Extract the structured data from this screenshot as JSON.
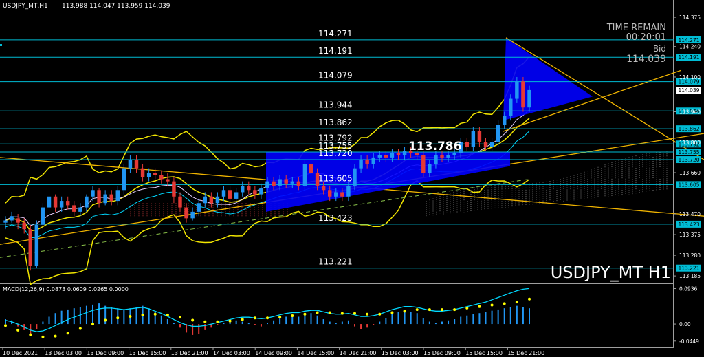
{
  "header": {
    "symbol": "USDJPY_MT,H1",
    "ohlc": "113.988 114.047 113.959 114.039"
  },
  "info": {
    "time_remain_label": "TIME REMAIN",
    "time_remain_value": "00:20:01",
    "bid_label": "Bid",
    "bid_value": "114.039"
  },
  "watermark": "USDJPY_MT H1",
  "pattern_label": "113.786",
  "colors": {
    "level_line": "#00bcd4",
    "bull": "#2196f3",
    "bear": "#e53935",
    "band": "#f2e600",
    "trend": "#f0b400",
    "triangle": "#0000ff",
    "macd_line": "#00d8ff",
    "macd_signal": "#ffff00"
  },
  "levels": [
    {
      "label": "114.271",
      "price": 114.271
    },
    {
      "label": "114.191",
      "price": 114.191
    },
    {
      "label": "114.079",
      "price": 114.079
    },
    {
      "label": "113.944",
      "price": 113.944
    },
    {
      "label": "113.862",
      "price": 113.862
    },
    {
      "label": "113.792",
      "price": 113.792
    },
    {
      "label": "113.755",
      "price": 113.755
    },
    {
      "label": "113.720",
      "price": 113.72
    },
    {
      "label": "113.605",
      "price": 113.605
    },
    {
      "label": "113.423",
      "price": 113.423
    },
    {
      "label": "113.221",
      "price": 113.221
    }
  ],
  "price_axis": {
    "ticks": [
      "114.375",
      "114.240",
      "114.100",
      "113.940",
      "113.800",
      "113.660",
      "113.470",
      "113.375",
      "113.280",
      "113.185"
    ],
    "current": "114.039",
    "range": [
      113.16,
      114.41
    ]
  },
  "macd": {
    "label": "MACD(12,26,9) 0.0873 0.0609 0.0265 0.0000",
    "ticks": [
      "0.0936",
      "0.00",
      "-0.0449"
    ],
    "range": [
      -0.058,
      0.1
    ]
  },
  "time_axis": [
    "10 Dec 2021",
    "13 Dec 03:00",
    "13 Dec 09:00",
    "13 Dec 15:00",
    "13 Dec 21:00",
    "14 Dec 03:00",
    "14 Dec 09:00",
    "14 Dec 15:00",
    "14 Dec 21:00",
    "15 Dec 03:00",
    "15 Dec 09:00",
    "15 Dec 15:00",
    "15 Dec 21:00"
  ],
  "candles": [
    [
      113.43,
      113.44,
      113.4,
      113.46
    ],
    [
      113.44,
      113.46,
      113.43,
      113.48
    ],
    [
      113.45,
      113.43,
      113.4,
      113.47
    ],
    [
      113.43,
      113.4,
      113.38,
      113.45
    ],
    [
      113.4,
      113.23,
      113.21,
      113.42
    ],
    [
      113.23,
      113.42,
      113.22,
      113.44
    ],
    [
      113.42,
      113.5,
      113.4,
      113.52
    ],
    [
      113.5,
      113.55,
      113.48,
      113.57
    ],
    [
      113.55,
      113.5,
      113.48,
      113.56
    ],
    [
      113.5,
      113.53,
      113.48,
      113.55
    ],
    [
      113.53,
      113.51,
      113.49,
      113.55
    ],
    [
      113.51,
      113.48,
      113.46,
      113.53
    ],
    [
      113.48,
      113.5,
      113.46,
      113.52
    ],
    [
      113.5,
      113.55,
      113.48,
      113.56
    ],
    [
      113.55,
      113.58,
      113.53,
      113.6
    ],
    [
      113.58,
      113.52,
      113.5,
      113.59
    ],
    [
      113.52,
      113.56,
      113.51,
      113.58
    ],
    [
      113.56,
      113.53,
      113.51,
      113.58
    ],
    [
      113.53,
      113.58,
      113.51,
      113.6
    ],
    [
      113.58,
      113.68,
      113.56,
      113.7
    ],
    [
      113.68,
      113.72,
      113.66,
      113.74
    ],
    [
      113.72,
      113.68,
      113.66,
      113.74
    ],
    [
      113.68,
      113.64,
      113.62,
      113.7
    ],
    [
      113.64,
      113.66,
      113.62,
      113.68
    ],
    [
      113.66,
      113.65,
      113.63,
      113.68
    ],
    [
      113.65,
      113.63,
      113.61,
      113.67
    ],
    [
      113.63,
      113.62,
      113.6,
      113.66
    ],
    [
      113.62,
      113.55,
      113.52,
      113.64
    ],
    [
      113.55,
      113.5,
      113.48,
      113.57
    ],
    [
      113.5,
      113.45,
      113.43,
      113.52
    ],
    [
      113.45,
      113.48,
      113.44,
      113.5
    ],
    [
      113.48,
      113.52,
      113.46,
      113.54
    ],
    [
      113.52,
      113.55,
      113.5,
      113.57
    ],
    [
      113.55,
      113.52,
      113.5,
      113.57
    ],
    [
      113.52,
      113.55,
      113.5,
      113.57
    ],
    [
      113.55,
      113.58,
      113.53,
      113.6
    ],
    [
      113.58,
      113.54,
      113.52,
      113.6
    ],
    [
      113.54,
      113.57,
      113.52,
      113.59
    ],
    [
      113.57,
      113.6,
      113.55,
      113.62
    ],
    [
      113.6,
      113.58,
      113.56,
      113.62
    ],
    [
      113.58,
      113.56,
      113.54,
      113.6
    ],
    [
      113.56,
      113.59,
      113.54,
      113.61
    ],
    [
      113.59,
      113.62,
      113.57,
      113.64
    ],
    [
      113.62,
      113.6,
      113.58,
      113.64
    ],
    [
      113.6,
      113.63,
      113.58,
      113.65
    ],
    [
      113.63,
      113.61,
      113.59,
      113.65
    ],
    [
      113.61,
      113.62,
      113.59,
      113.64
    ],
    [
      113.62,
      113.6,
      113.58,
      113.64
    ],
    [
      113.6,
      113.7,
      113.58,
      113.72
    ],
    [
      113.7,
      113.66,
      113.64,
      113.72
    ],
    [
      113.66,
      113.6,
      113.58,
      113.68
    ],
    [
      113.6,
      113.58,
      113.56,
      113.62
    ],
    [
      113.58,
      113.55,
      113.53,
      113.6
    ],
    [
      113.55,
      113.57,
      113.53,
      113.59
    ],
    [
      113.57,
      113.55,
      113.53,
      113.59
    ],
    [
      113.55,
      113.6,
      113.53,
      113.62
    ],
    [
      113.6,
      113.68,
      113.58,
      113.7
    ],
    [
      113.68,
      113.72,
      113.66,
      113.74
    ],
    [
      113.72,
      113.7,
      113.68,
      113.74
    ],
    [
      113.7,
      113.73,
      113.68,
      113.75
    ],
    [
      113.73,
      113.74,
      113.71,
      113.76
    ],
    [
      113.74,
      113.73,
      113.71,
      113.76
    ],
    [
      113.73,
      113.75,
      113.71,
      113.77
    ],
    [
      113.75,
      113.74,
      113.72,
      113.77
    ],
    [
      113.74,
      113.76,
      113.72,
      113.78
    ],
    [
      113.76,
      113.75,
      113.73,
      113.78
    ],
    [
      113.75,
      113.74,
      113.72,
      113.77
    ],
    [
      113.74,
      113.66,
      113.64,
      113.76
    ],
    [
      113.66,
      113.7,
      113.64,
      113.72
    ],
    [
      113.7,
      113.74,
      113.68,
      113.76
    ],
    [
      113.74,
      113.73,
      113.71,
      113.76
    ],
    [
      113.73,
      113.74,
      113.71,
      113.76
    ],
    [
      113.74,
      113.75,
      113.72,
      113.77
    ],
    [
      113.75,
      113.8,
      113.73,
      113.82
    ],
    [
      113.8,
      113.78,
      113.76,
      113.82
    ],
    [
      113.78,
      113.85,
      113.76,
      113.87
    ],
    [
      113.85,
      113.8,
      113.78,
      113.87
    ],
    [
      113.8,
      113.78,
      113.76,
      113.82
    ],
    [
      113.78,
      113.8,
      113.76,
      113.82
    ],
    [
      113.8,
      113.88,
      113.78,
      113.9
    ],
    [
      113.88,
      113.92,
      113.86,
      113.94
    ],
    [
      113.92,
      114.0,
      113.9,
      114.02
    ],
    [
      114.0,
      114.08,
      113.98,
      114.1
    ],
    [
      114.08,
      113.96,
      113.94,
      114.1
    ],
    [
      113.96,
      114.04,
      113.94,
      114.06
    ]
  ],
  "macd_hist": [
    0.008,
    0.006,
    -0.004,
    -0.01,
    -0.016,
    -0.008,
    0.004,
    0.012,
    0.018,
    0.022,
    0.024,
    0.026,
    0.028,
    0.03,
    0.032,
    0.034,
    0.03,
    0.028,
    0.026,
    0.024,
    0.026,
    0.028,
    0.03,
    0.026,
    0.02,
    0.014,
    0.008,
    0.002,
    -0.006,
    -0.014,
    -0.018,
    -0.016,
    -0.01,
    -0.006,
    -0.002,
    0.002,
    0.004,
    0.006,
    0.004,
    0.002,
    -0.002,
    -0.004,
    0.002,
    0.006,
    0.01,
    0.012,
    0.014,
    0.012,
    0.016,
    0.018,
    0.014,
    0.008,
    0.004,
    0.002,
    0.004,
    0.006,
    -0.004,
    -0.008,
    -0.006,
    -0.002,
    0.004,
    0.01,
    0.016,
    0.02,
    0.022,
    0.02,
    0.018,
    0.01,
    0.004,
    0.002,
    0.004,
    0.006,
    0.008,
    0.012,
    0.014,
    0.016,
    0.018,
    0.02,
    0.022,
    0.024,
    0.026,
    0.028,
    0.03,
    0.028,
    0.026
  ],
  "macd_line": [
    0.01,
    0.006,
    0.0,
    -0.008,
    -0.016,
    -0.02,
    -0.018,
    -0.012,
    -0.004,
    0.004,
    0.012,
    0.018,
    0.024,
    0.03,
    0.036,
    0.04,
    0.042,
    0.042,
    0.04,
    0.038,
    0.04,
    0.042,
    0.044,
    0.04,
    0.034,
    0.028,
    0.02,
    0.012,
    0.004,
    -0.002,
    -0.006,
    -0.006,
    -0.004,
    0.0,
    0.004,
    0.008,
    0.012,
    0.016,
    0.018,
    0.018,
    0.016,
    0.014,
    0.016,
    0.02,
    0.024,
    0.028,
    0.03,
    0.03,
    0.034,
    0.036,
    0.036,
    0.032,
    0.028,
    0.026,
    0.026,
    0.028,
    0.024,
    0.02,
    0.02,
    0.022,
    0.026,
    0.032,
    0.038,
    0.042,
    0.046,
    0.046,
    0.044,
    0.04,
    0.036,
    0.034,
    0.034,
    0.036,
    0.038,
    0.042,
    0.046,
    0.05,
    0.054,
    0.058,
    0.064,
    0.07,
    0.076,
    0.082,
    0.088,
    0.092,
    0.094
  ],
  "macd_signal": [
    -0.004,
    -0.01,
    -0.016,
    -0.022,
    -0.028,
    -0.032,
    -0.034,
    -0.034,
    -0.032,
    -0.028,
    -0.024,
    -0.018,
    -0.012,
    -0.006,
    0.0,
    0.006,
    0.01,
    0.014,
    0.016,
    0.018,
    0.02,
    0.022,
    0.024,
    0.026,
    0.026,
    0.026,
    0.024,
    0.022,
    0.018,
    0.014,
    0.01,
    0.008,
    0.006,
    0.006,
    0.006,
    0.006,
    0.008,
    0.01,
    0.012,
    0.014,
    0.016,
    0.016,
    0.016,
    0.016,
    0.018,
    0.02,
    0.022,
    0.024,
    0.026,
    0.028,
    0.03,
    0.03,
    0.03,
    0.03,
    0.028,
    0.028,
    0.028,
    0.028,
    0.026,
    0.026,
    0.026,
    0.028,
    0.03,
    0.032,
    0.034,
    0.036,
    0.038,
    0.038,
    0.038,
    0.038,
    0.038,
    0.038,
    0.038,
    0.04,
    0.042,
    0.044,
    0.046,
    0.048,
    0.05,
    0.052,
    0.054,
    0.056,
    0.058,
    0.062,
    0.066
  ]
}
